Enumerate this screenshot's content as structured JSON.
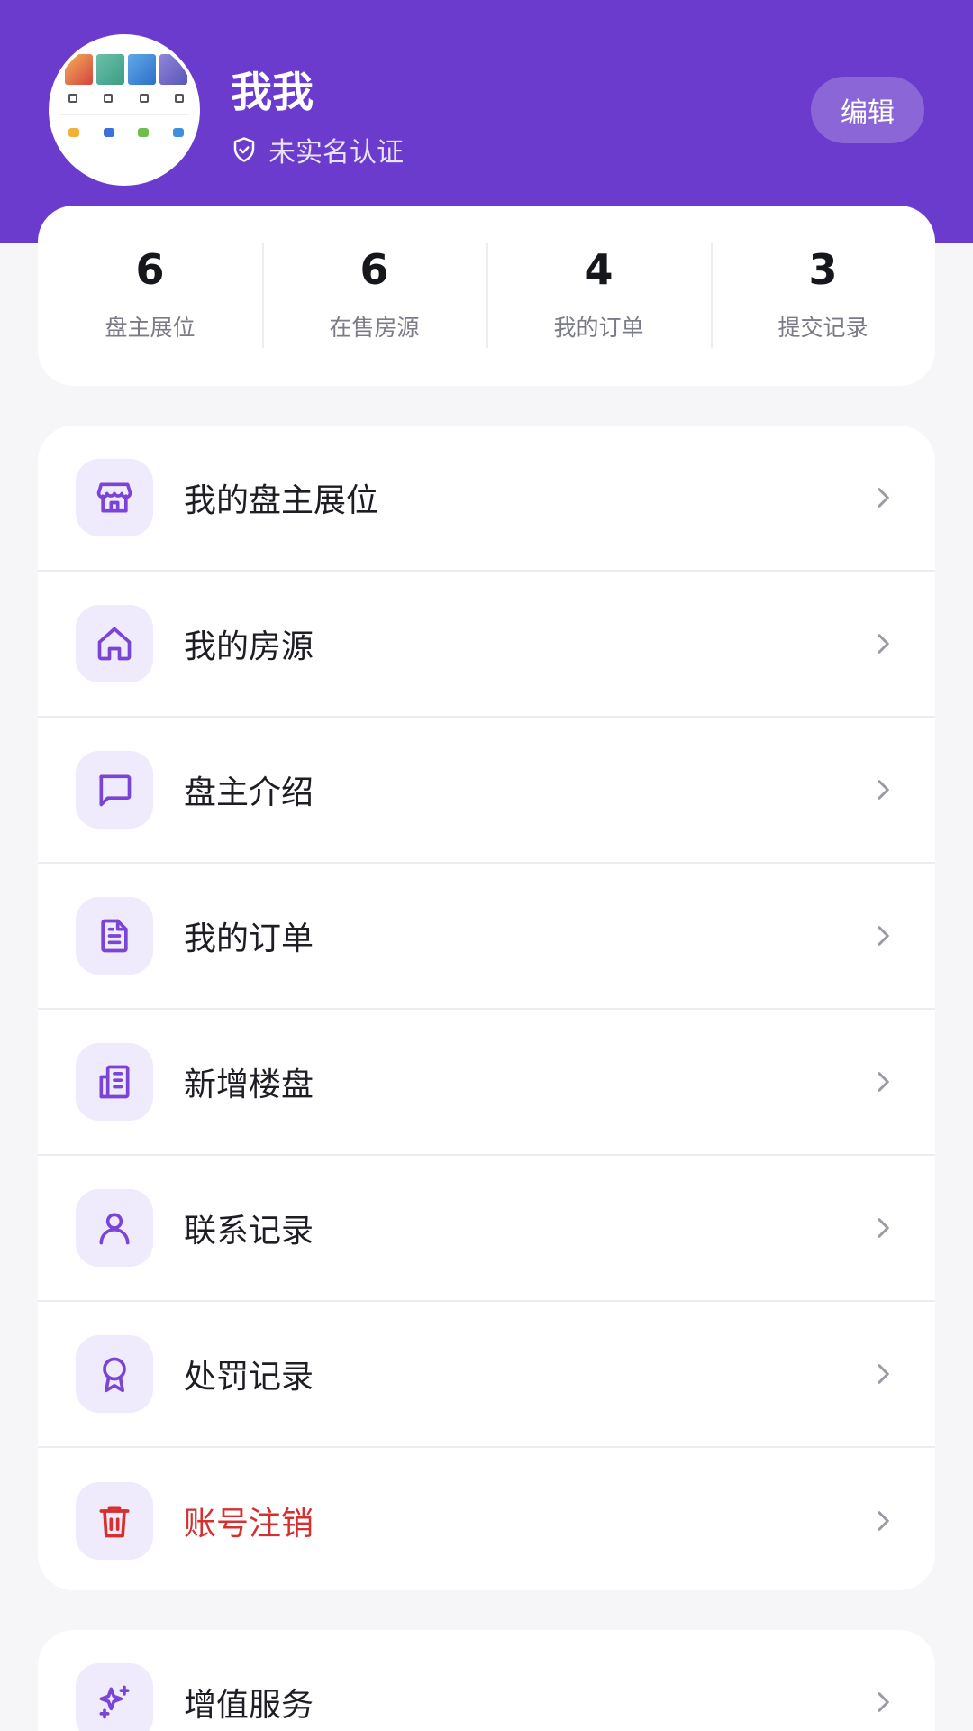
{
  "profile": {
    "name": "我我",
    "verification_status": "未实名认证",
    "edit_label": "编辑"
  },
  "stats": [
    {
      "value": "6",
      "label": "盘主展位"
    },
    {
      "value": "6",
      "label": "在售房源"
    },
    {
      "value": "4",
      "label": "我的订单"
    },
    {
      "value": "3",
      "label": "提交记录"
    }
  ],
  "menu": [
    {
      "label": "我的盘主展位",
      "icon": "store-icon"
    },
    {
      "label": "我的房源",
      "icon": "home-icon"
    },
    {
      "label": "盘主介绍",
      "icon": "message-icon"
    },
    {
      "label": "我的订单",
      "icon": "document-icon"
    },
    {
      "label": "新增楼盘",
      "icon": "building-icon"
    },
    {
      "label": "联系记录",
      "icon": "user-icon"
    },
    {
      "label": "处罚记录",
      "icon": "award-icon"
    },
    {
      "label": "账号注销",
      "icon": "trash-icon"
    }
  ],
  "extra_menu": [
    {
      "label": "增值服务",
      "icon": "sparkles-icon"
    }
  ],
  "colors": {
    "brand": "#6a3bcc",
    "icon_bg": "#efeafc",
    "icon": "#7a45d6",
    "danger": "#d62f2f"
  }
}
